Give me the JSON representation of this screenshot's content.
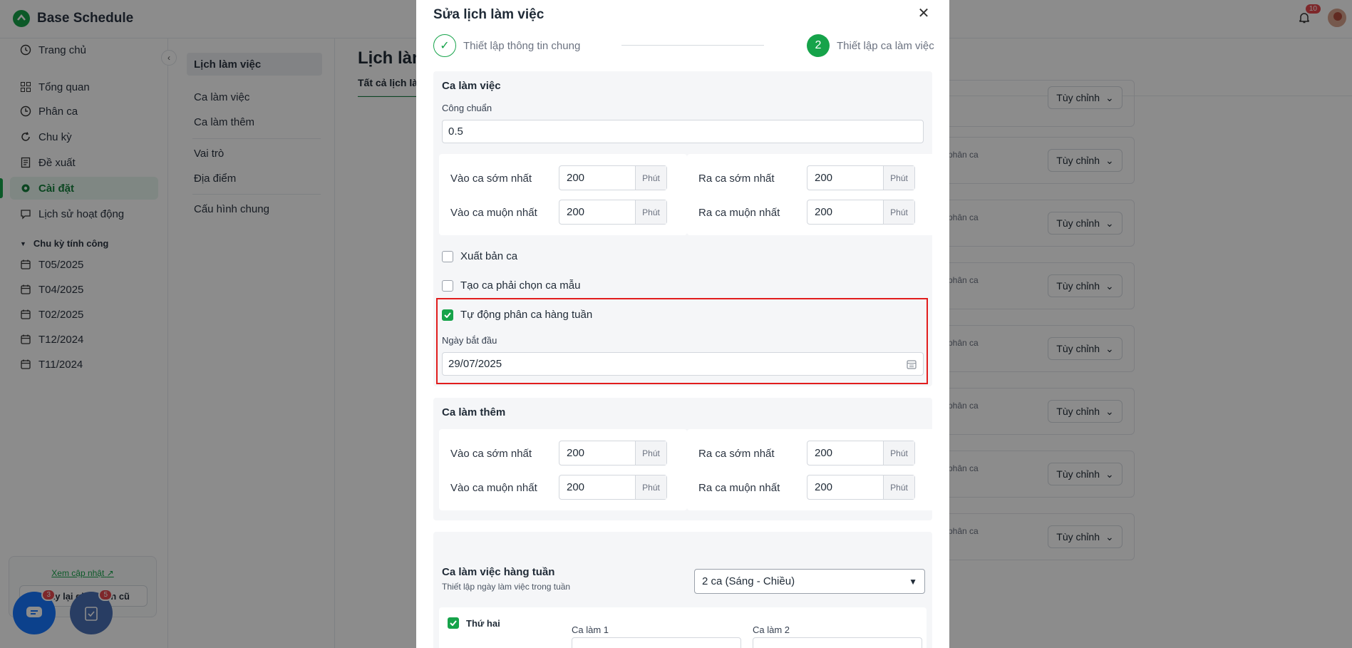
{
  "app": {
    "name": "Base Schedule",
    "notification_count": "10"
  },
  "sidebar": {
    "items": [
      {
        "label": "Trang chủ"
      },
      {
        "label": "Tổng quan"
      },
      {
        "label": "Phân ca"
      },
      {
        "label": "Chu kỳ"
      },
      {
        "label": "Đề xuất"
      },
      {
        "label": "Cài đặt"
      },
      {
        "label": "Lịch sử hoạt động"
      }
    ],
    "cycle_header": "Chu kỳ tính công",
    "cycles": [
      "T05/2025",
      "T04/2025",
      "T02/2025",
      "T12/2024",
      "T11/2024"
    ],
    "update_link": "Xem cập nhật",
    "legacy_button": "Quay lại giao diện cũ",
    "chat_badge": "3",
    "task_badge": "5"
  },
  "subnav": {
    "items": [
      "Lịch làm việc",
      "Ca làm việc",
      "Ca làm thêm",
      "Vai trò",
      "Địa điểm",
      "Cấu hình chung"
    ]
  },
  "content": {
    "title": "Lịch làm",
    "tab": "Tất cả lịch là",
    "row_text": "phân ca",
    "custom_button": "Tùy chỉnh"
  },
  "modal": {
    "title": "Sửa lịch làm việc",
    "step1_label": "Thiết lập thông tin chung",
    "step2_number": "2",
    "step2_label": "Thiết lập ca làm việc",
    "shift_section": {
      "title": "Ca làm việc",
      "standard_label": "Công chuẩn",
      "standard_value": "0.5",
      "early_in_label": "Vào ca sớm nhất",
      "late_in_label": "Vào ca muộn nhất",
      "early_out_label": "Ra ca sớm nhất",
      "late_out_label": "Ra ca muộn nhất",
      "minutes_value": "200",
      "unit": "Phút",
      "export_label": "Xuất bản ca",
      "template_label": "Tạo ca phải chọn ca mẫu",
      "auto_label": "Tự động phân ca hàng tuần",
      "start_date_label": "Ngày bắt đầu",
      "start_date_value": "29/07/2025"
    },
    "overtime_section": {
      "title": "Ca làm thêm"
    },
    "weekly_section": {
      "title": "Ca làm việc hàng tuần",
      "subtitle": "Thiết lập ngày làm việc trong tuần",
      "select_value": "2 ca (Sáng - Chiều)",
      "day_label": "Thứ hai",
      "shift1_label": "Ca làm 1",
      "shift2_label": "Ca làm 2"
    }
  },
  "colors": {
    "brand": "#16a34a",
    "highlight": "#e11d1d"
  }
}
